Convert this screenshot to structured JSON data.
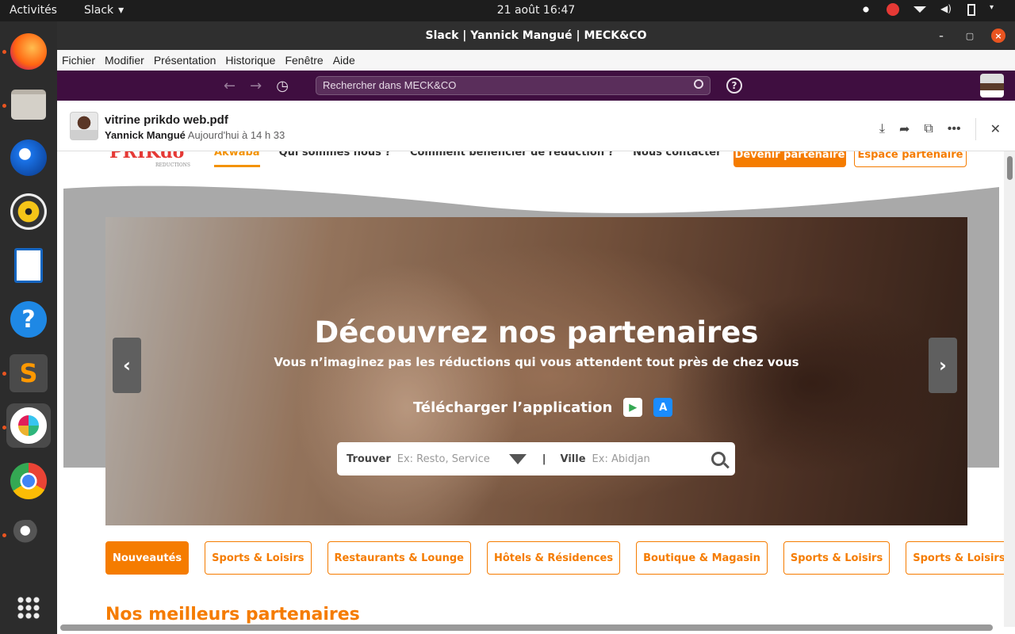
{
  "topbar": {
    "activities": "Activités",
    "app_name": "Slack",
    "clock": "21 août  16:47"
  },
  "window": {
    "title": "Slack | Yannick Mangué | MECK&CO",
    "minimize": "–",
    "maximize": "▢",
    "close": "×"
  },
  "menu": {
    "items": [
      "Fichier",
      "Modifier",
      "Présentation",
      "Historique",
      "Fenêtre",
      "Aide"
    ]
  },
  "slack": {
    "search_placeholder": "Rechercher dans MECK&CO",
    "help": "?"
  },
  "file": {
    "name": "vitrine prikdo web.pdf",
    "author": "Yannick Mangué",
    "time": "Aujourd'hui à 14 h 33"
  },
  "site": {
    "logo": "PRIKdo",
    "logo_tag": "REDUCTIONS",
    "nav": [
      "Akwaba",
      "Qui sommes nous ?",
      "Comment bénéficier de réduction ?",
      "Nous contacter"
    ],
    "btn_partner": "Devenir partenaire",
    "btn_space": "Espace partenaire",
    "hero_title": "Découvrez nos partenaires",
    "hero_sub": "Vous n’imaginez pas les réductions qui vous attendent tout près de chez vous",
    "download": "Télécharger l’application",
    "search_find_label": "Trouver",
    "search_find_placeholder": "Ex: Resto, Service",
    "search_city_label": "Ville",
    "search_city_placeholder": "Ex: Abidjan",
    "categories": [
      "Nouveautés",
      "Sports & Loisirs",
      "Restaurants & Lounge",
      "Hôtels & Résidences",
      "Boutique & Magasin",
      "Sports & Loisirs",
      "Sports & Loisirs"
    ],
    "best_partners": "Nos meilleurs partenaires"
  },
  "colors": {
    "accent": "#f57c00",
    "slack_bar": "#3f0e40",
    "ubuntu_orange": "#e95420"
  }
}
